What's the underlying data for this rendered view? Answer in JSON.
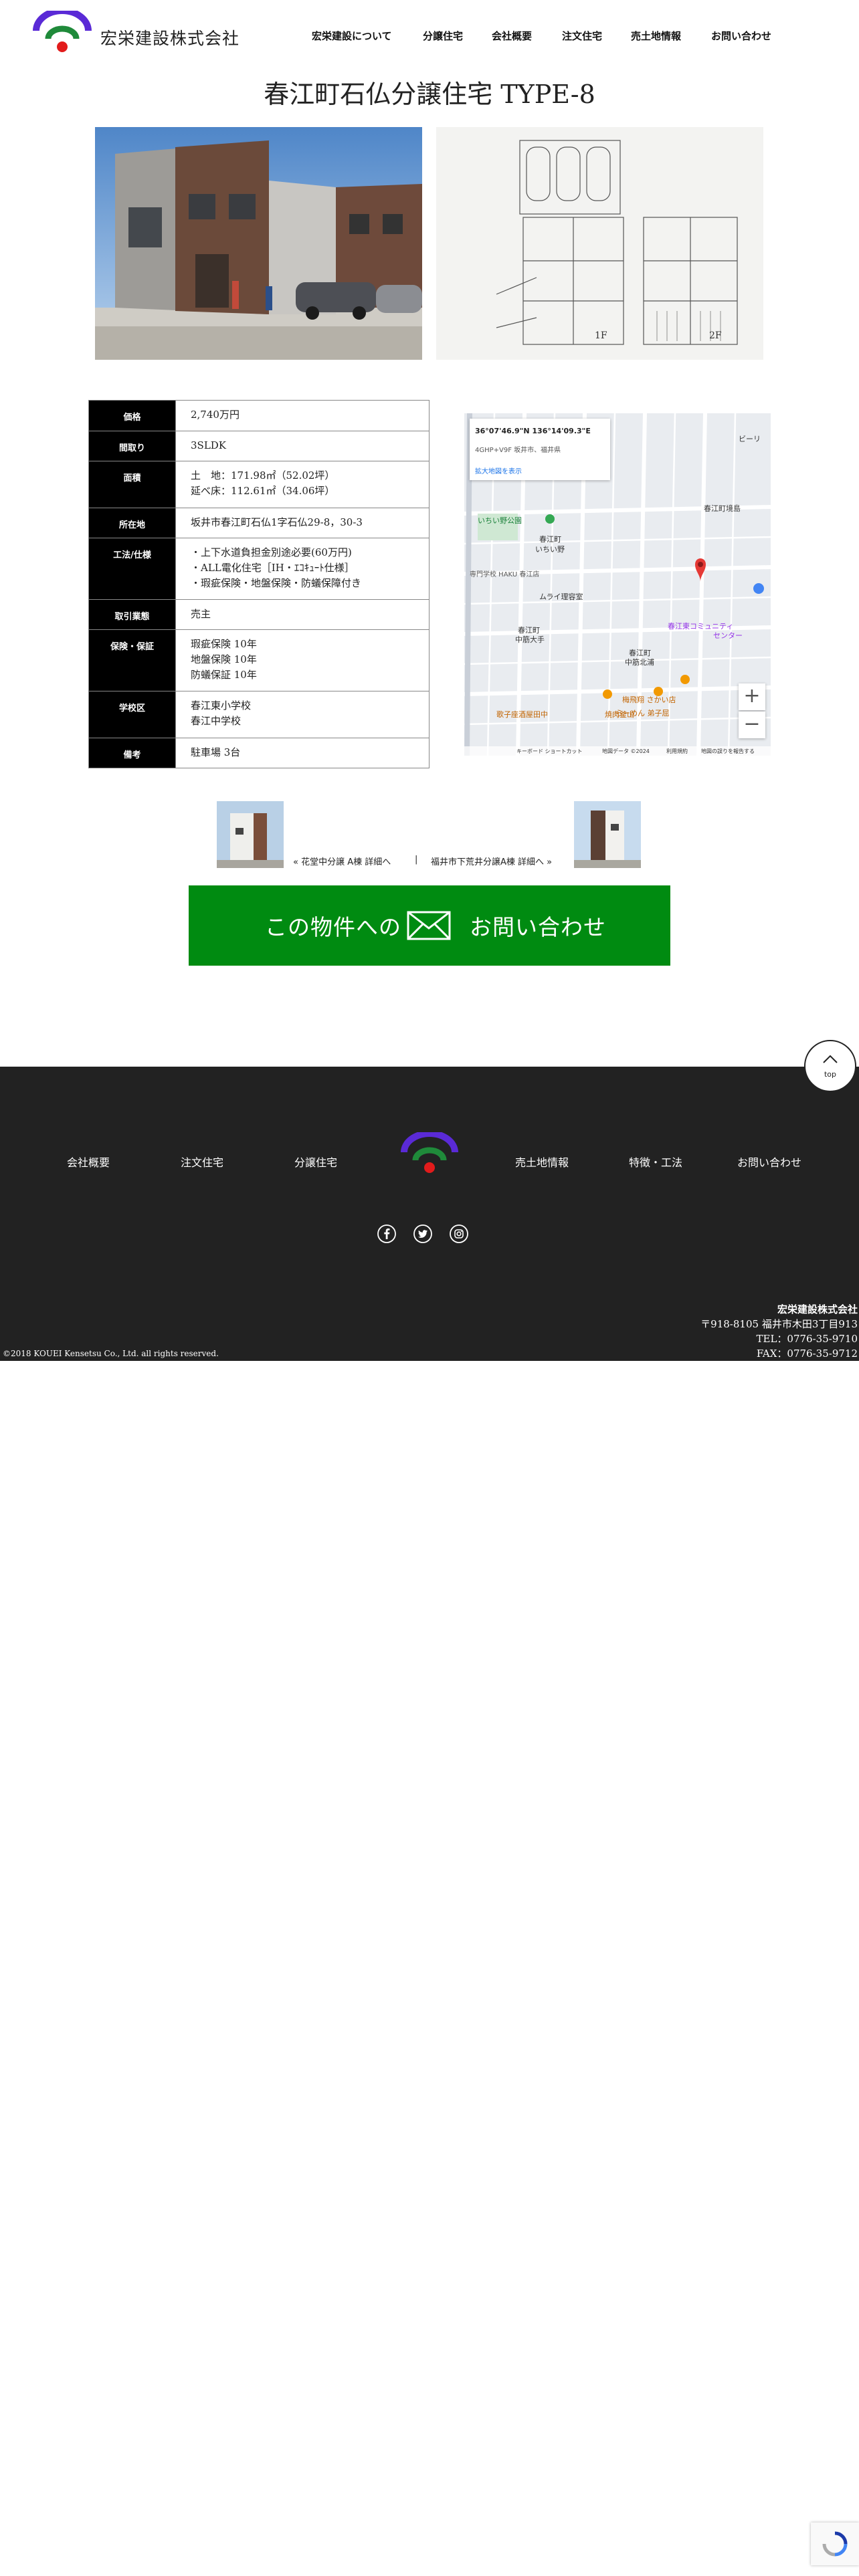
{
  "header": {
    "company_name": "宏栄建設株式会社",
    "nav": [
      "宏栄建設について",
      "分譲住宅",
      "会社概要",
      "注文住宅",
      "売土地情報",
      "お問い合わせ"
    ]
  },
  "page": {
    "title": "春江町石仏分譲住宅 TYPE-8"
  },
  "floorplan": {
    "label_1f": "1F",
    "label_2f": "2F"
  },
  "spec": {
    "rows": [
      {
        "label": "価格",
        "lines": [
          "2,740万円"
        ]
      },
      {
        "label": "間取り",
        "lines": [
          "3SLDK"
        ]
      },
      {
        "label": "面積",
        "lines": [
          "土　地：171.98㎡（52.02坪）",
          "延べ床：112.61㎡（34.06坪）"
        ]
      },
      {
        "label": "所在地",
        "lines": [
          "坂井市春江町石仏1字石仏29-8，30-3"
        ]
      },
      {
        "label": "工法/仕様",
        "lines": [
          "・上下水道負担金別途必要(60万円)",
          "・ALL電化住宅［IH・ｴｺｷｭｰﾄ仕様］",
          "・瑕疵保険・地盤保険・防蟻保障付き"
        ]
      },
      {
        "label": "取引業態",
        "lines": [
          "売主"
        ]
      },
      {
        "label": "保険・保証",
        "lines": [
          "瑕疵保険 10年",
          "地盤保険 10年",
          "防蟻保証 10年"
        ]
      },
      {
        "label": "学校区",
        "lines": [
          "春江東小学校",
          "春江中学校"
        ]
      },
      {
        "label": "備考",
        "lines": [
          "駐車場 3台"
        ]
      }
    ]
  },
  "map": {
    "coords": "36°07'46.9\"N 136°14'09.3\"E",
    "address": "4GHP+V9F 坂井市、福井県",
    "link": "拡大地図を表示",
    "labels": [
      "ビーリ",
      "春江町境島",
      "いちい野公園",
      "春江町",
      "いちい野",
      "専門学校 HAKU 春江店",
      "ムライ理容室",
      "春江町",
      "中筋大手",
      "春江町",
      "中筋北浦",
      "春江東コミュニティ",
      "センター",
      "梅飛翔 さかい店",
      "らーめん 弟子屈",
      "歌子座酒屋田中",
      "焼肉釜山"
    ],
    "footer": [
      "キーボード ショートカット",
      "地図データ ©2024",
      "利用規約",
      "地図の誤りを報告する"
    ],
    "zoom_in": "+",
    "zoom_out": "−"
  },
  "pager": {
    "prev": "« 花堂中分譲 A棟 詳細へ",
    "separator": "|",
    "next": "福井市下荒井分譲A棟 詳細へ »"
  },
  "cta": {
    "left": "この物件への",
    "right": "お問い合わせ"
  },
  "top_button": {
    "label": "top"
  },
  "footer": {
    "nav": [
      "会社概要",
      "注文住宅",
      "分譲住宅",
      "売土地情報",
      "特徴・工法",
      "お問い合わせ"
    ],
    "company": "宏栄建設株式会社",
    "address": "〒918-8105 福井市木田3丁目913",
    "tel": "TEL：0776-35-9710",
    "fax": "FAX：0776-35-9712",
    "copyright": "©2018 KOUEI Kensetsu Co., Ltd. all rights reserved."
  },
  "colors": {
    "cta_green": "#008b11",
    "footer_bg": "#222222",
    "logo_blue": "#2a2bd6",
    "logo_purple": "#6a1fc2",
    "logo_green": "#1f8a3a",
    "logo_red": "#e21b1b"
  }
}
